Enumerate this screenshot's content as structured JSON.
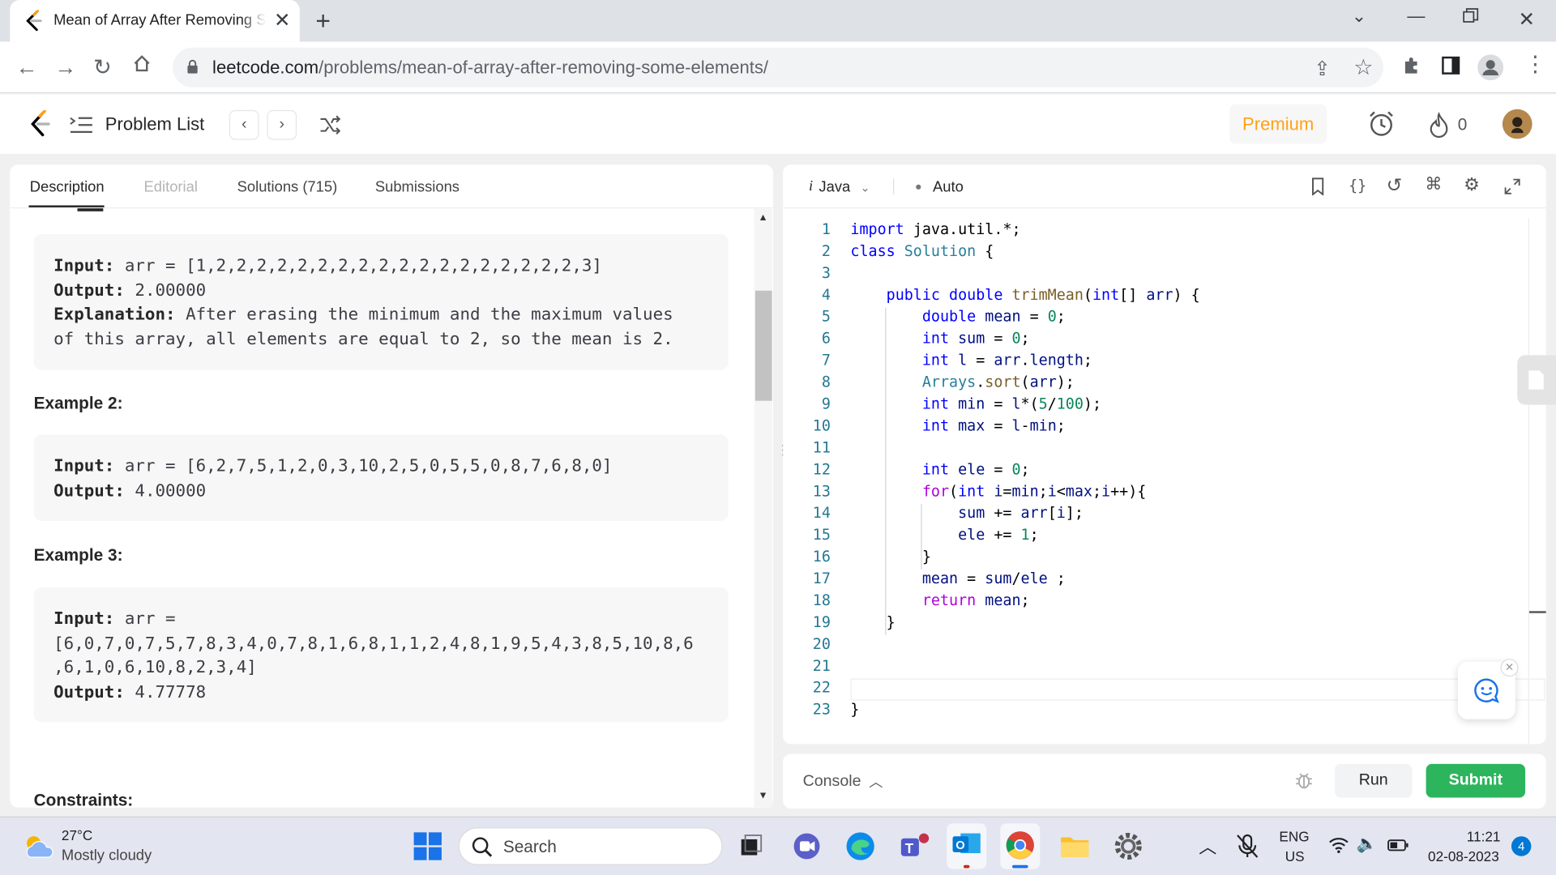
{
  "browser": {
    "tab_title": "Mean of Array After Removing Some Elements",
    "url_domain": "leetcode.com",
    "url_path": "/problems/mean-of-array-after-removing-some-elements/"
  },
  "header": {
    "problem_list": "Problem List",
    "premium": "Premium",
    "streak_count": "0"
  },
  "left": {
    "tabs": [
      "Description",
      "Editorial",
      "Solutions (715)",
      "Submissions"
    ],
    "example1": {
      "input_label": "Input:",
      "input": "arr = [1,2,2,2,2,2,2,2,2,2,2,2,2,2,2,2,2,2,2,3]",
      "output_label": "Output:",
      "output": "2.00000",
      "explanation_label": "Explanation:",
      "explanation_line1": "After erasing the minimum and the maximum values",
      "explanation_line2": "of this array, all elements are equal to 2, so the mean is 2."
    },
    "example2_heading": "Example 2:",
    "example2": {
      "input_label": "Input:",
      "input": "arr = [6,2,7,5,1,2,0,3,10,2,5,0,5,5,0,8,7,6,8,0]",
      "output_label": "Output:",
      "output": "4.00000"
    },
    "example3_heading": "Example 3:",
    "example3": {
      "input_label": "Input:",
      "input_line1": "arr =",
      "input_line2": "[6,0,7,0,7,5,7,8,3,4,0,7,8,1,6,8,1,1,2,4,8,1,9,5,4,3,8,5,10,8,6",
      "input_line3": ",6,1,0,6,10,8,2,3,4]",
      "output_label": "Output:",
      "output": "4.77778"
    },
    "constraints_heading": "Constraints:"
  },
  "editor": {
    "language": "Java",
    "mode": "Auto",
    "line_numbers": [
      "1",
      "2",
      "3",
      "4",
      "5",
      "6",
      "7",
      "8",
      "9",
      "10",
      "11",
      "12",
      "13",
      "14",
      "15",
      "16",
      "17",
      "18",
      "19",
      "20",
      "21",
      "22",
      "23"
    ]
  },
  "console": {
    "label": "Console",
    "run": "Run",
    "submit": "Submit"
  },
  "taskbar": {
    "temp": "27°C",
    "weather": "Mostly cloudy",
    "search": "Search",
    "lang1": "ENG",
    "lang2": "US",
    "time": "11:21",
    "date": "02-08-2023",
    "notif": "4"
  }
}
